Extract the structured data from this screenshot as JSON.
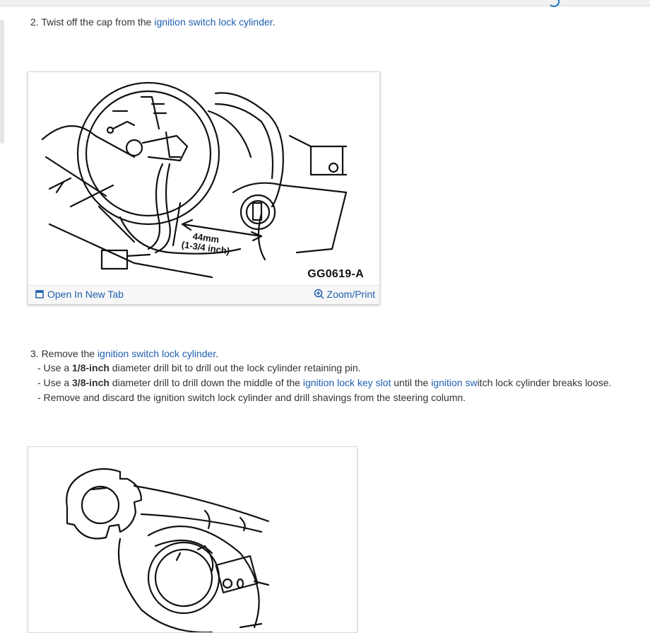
{
  "step2": {
    "prefix": "2. Twist off the cap from the ",
    "link": "ignition switch lock cylinder",
    "suffix": "."
  },
  "figure1": {
    "measure_mm": "44mm",
    "measure_in": "(1-3/4 inch)",
    "code": "GG0619-A",
    "open_tab": "Open In New Tab",
    "zoom": "Zoom/Print",
    "open_icon": "open-in-new-tab-icon",
    "zoom_icon": "zoom-in-icon"
  },
  "step3": {
    "prefix": "3. Remove the ",
    "link": "ignition switch lock cylinder",
    "suffix": ".",
    "items": [
      {
        "a": "- Use a ",
        "b": "1/8-inch",
        "c": " diameter drill bit to drill out the lock cylinder retaining pin."
      },
      {
        "a": "- Use a ",
        "b": "3/8-inch",
        "c": " diameter drill to drill down the middle of the ",
        "link1": "ignition lock key slot",
        "d": " until the ",
        "link2": "ignition sw",
        "e": "itch lock cylinder breaks loose."
      },
      {
        "a": "- Remove and discard the ignition switch lock cylinder and drill shavings from the steering column."
      }
    ]
  },
  "colors": {
    "link": "#1f5fb0",
    "text": "#333333",
    "accent": "#1a73c9"
  }
}
